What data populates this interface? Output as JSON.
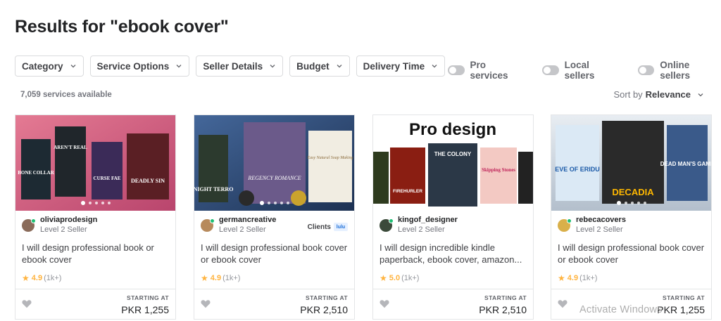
{
  "page": {
    "title": "Results for \"ebook cover\""
  },
  "filters": [
    {
      "label": "Category"
    },
    {
      "label": "Service Options"
    },
    {
      "label": "Seller Details"
    },
    {
      "label": "Budget"
    },
    {
      "label": "Delivery Time"
    }
  ],
  "toggles": [
    {
      "label": "Pro services",
      "on": false
    },
    {
      "label": "Local sellers",
      "on": false
    },
    {
      "label": "Online sellers",
      "on": false
    }
  ],
  "results": {
    "count_text": "7,059 services available",
    "sort_prefix": "Sort by",
    "sort_value": "Relevance"
  },
  "gigs": [
    {
      "seller": "oliviaprodesign",
      "level": "Level 2 Seller",
      "clients_label": "",
      "title": "I will design professional book or ebook cover",
      "rating": "4.9",
      "reviews": "(1k+)",
      "starting_label": "STARTING AT",
      "price": "PKR 1,255",
      "thumb_colors": [
        "#e06a86",
        "#b8446a"
      ],
      "book_titles": [
        "BONE COLLAR",
        "AREN'T REAL",
        "CURSE FAE",
        "DEADLY SIN"
      ]
    },
    {
      "seller": "germancreative",
      "level": "Level 2 Seller",
      "clients_label": "Clients",
      "title": "I will design professional book cover or ebook cover",
      "rating": "4.9",
      "reviews": "(1k+)",
      "starting_label": "STARTING AT",
      "price": "PKR 2,510",
      "thumb_colors": [
        "#3a5a8c",
        "#1f3358"
      ],
      "book_titles": [
        "NIGHT TERRO",
        "REGENCY ROMANCE",
        "Easy Natural Soap Making"
      ]
    },
    {
      "seller": "kingof_designer",
      "level": "Level 2 Seller",
      "clients_label": "",
      "title": "I will design incredible kindle paperback, ebook cover, amazon...",
      "rating": "5.0",
      "reviews": "(1k+)",
      "starting_label": "STARTING AT",
      "price": "PKR 2,510",
      "thumb_colors": [
        "#ffffff",
        "#f2f2f2"
      ],
      "thumb_heading": "Pro design",
      "book_titles": [
        "FIREHURLER",
        "THE COLONY",
        "Skipping Stones"
      ]
    },
    {
      "seller": "rebecacovers",
      "level": "Level 2 Seller",
      "clients_label": "",
      "title": "I will design professional book cover or ebook cover",
      "rating": "4.9",
      "reviews": "(1k+)",
      "starting_label": "STARTING AT",
      "price": "PKR 1,255",
      "thumb_colors": [
        "#dfe6ee",
        "#b8c3cf"
      ],
      "book_titles": [
        "EVE OF ERIDU",
        "DECADIA",
        "DEAD MAN'S GAME"
      ]
    }
  ],
  "watermark": "Activate Windows",
  "colors": {
    "accent_green": "#1dbf73",
    "star": "#ffb33e",
    "border": "#e4e5e7"
  }
}
